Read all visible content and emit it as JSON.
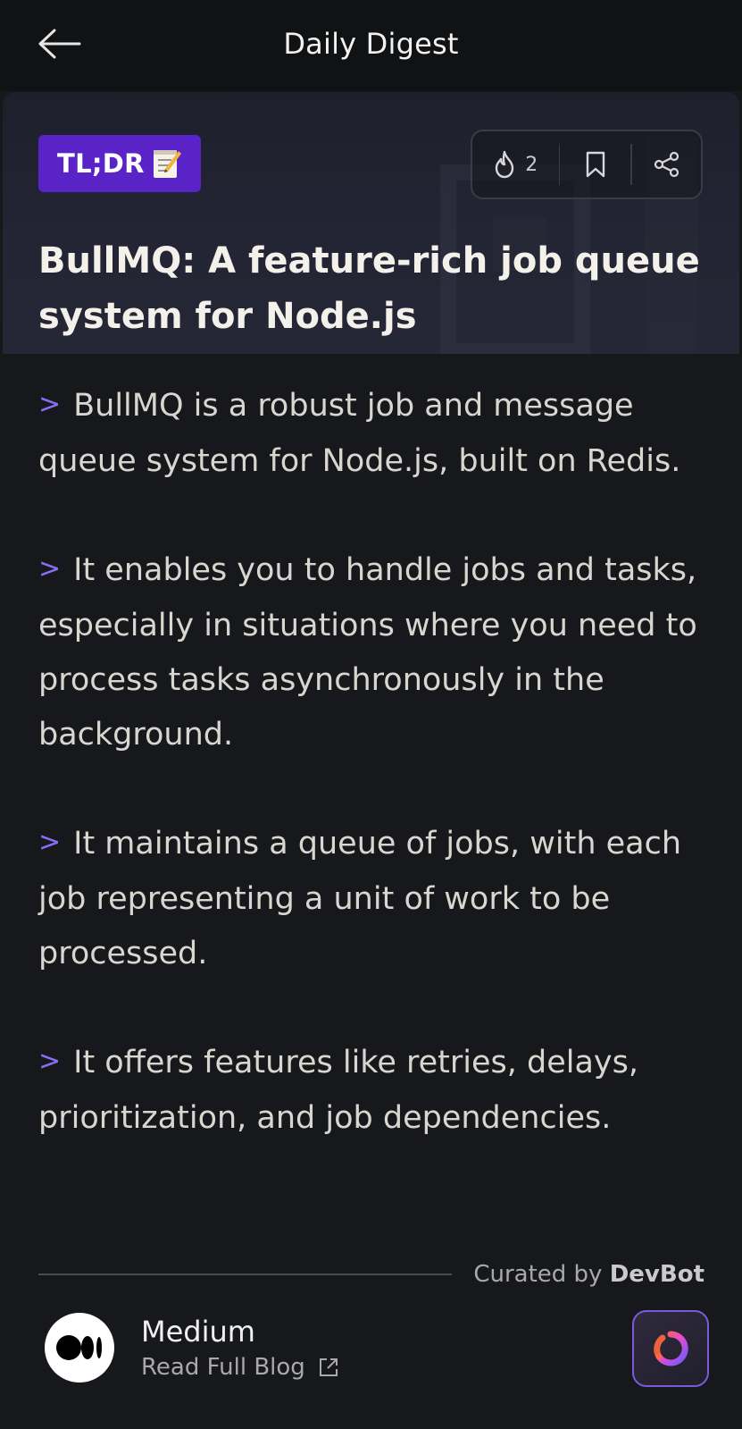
{
  "header": {
    "title": "Daily Digest",
    "back_icon": "arrow-left-icon"
  },
  "hero": {
    "badge_label": "TL;DR",
    "badge_emoji": "memo-icon",
    "badge_color": "#5a23c8",
    "title": "BullMQ: A feature-rich job queue system for Node.js",
    "actions": {
      "upvote_icon": "flame-icon",
      "upvote_count": "2",
      "bookmark_icon": "bookmark-icon",
      "share_icon": "share-icon"
    }
  },
  "summary": {
    "bullet_icon": ">",
    "bullet_color": "#8a6df5",
    "items": [
      "BullMQ is a robust job and message queue system for Node.js, built on Redis.",
      "It enables you to handle jobs and tasks, especially in situations where you need to process tasks asynchronously in the background.",
      "It maintains a queue of jobs, with each job representing a unit of work to be processed.",
      "It offers features like retries, delays, prioritization, and job dependencies."
    ]
  },
  "footer": {
    "curated_prefix": "Curated by",
    "curated_by": "DevBot",
    "source_name": "Medium",
    "read_label": "Read Full Blog",
    "source_icon": "medium-logo-icon",
    "external_icon": "external-link-icon",
    "fab_icon": "app-logo-icon"
  }
}
